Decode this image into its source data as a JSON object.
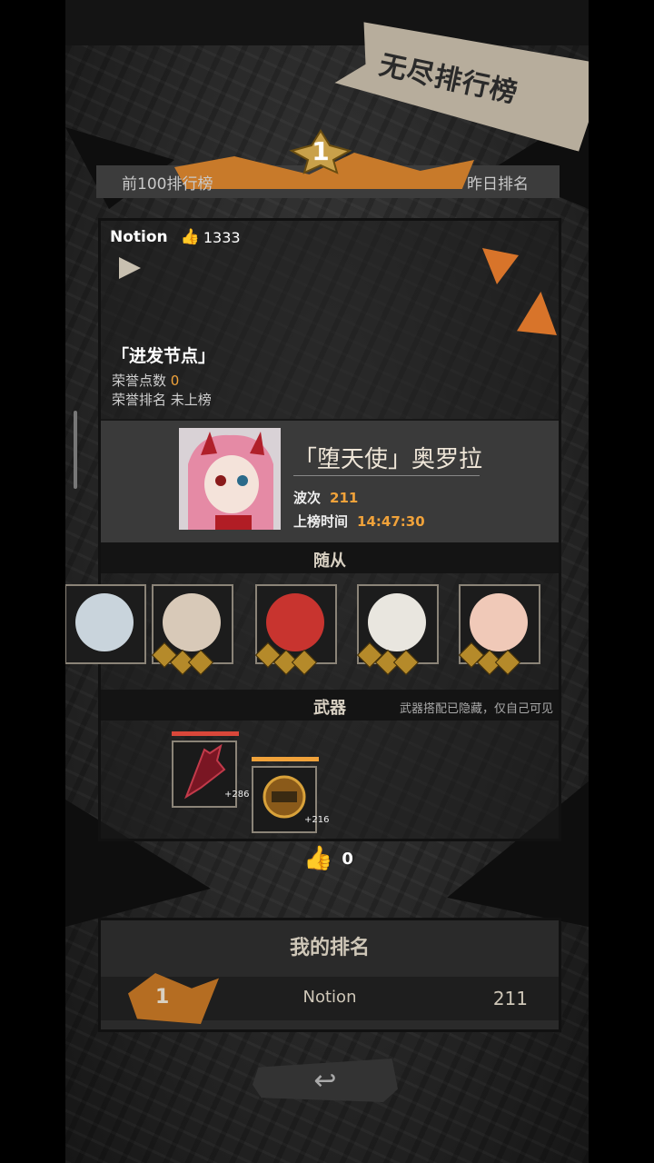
{
  "banner_title": "无尽排行榜",
  "top_rank": "1",
  "tabs": {
    "left": "前100排行榜",
    "right": "昨日排名"
  },
  "card": {
    "username": "Notion",
    "likes": "1333",
    "node_title": "「进发节点」",
    "honor_points_label": "荣誉点数",
    "honor_points": "0",
    "honor_rank_label": "荣誉排名",
    "honor_rank": "未上榜"
  },
  "hero": {
    "name": "「堕天使」奥罗拉",
    "wave_label": "波次",
    "wave": "211",
    "time_label": "上榜时间",
    "time": "14:47:30"
  },
  "followers_title": "随从",
  "weapons": {
    "title": "武器",
    "note": "武器搭配已隐藏，仅自己可见",
    "items": [
      {
        "bonus": "+286"
      },
      {
        "bonus": "+216"
      }
    ]
  },
  "bottom_likes": "0",
  "my_rank": {
    "title": "我的排名",
    "rank": "1",
    "name": "Notion",
    "wave": "211"
  },
  "colors": {
    "accent": "#f0a23a",
    "orange": "#d8742a",
    "panel": "#2a2a2a"
  }
}
